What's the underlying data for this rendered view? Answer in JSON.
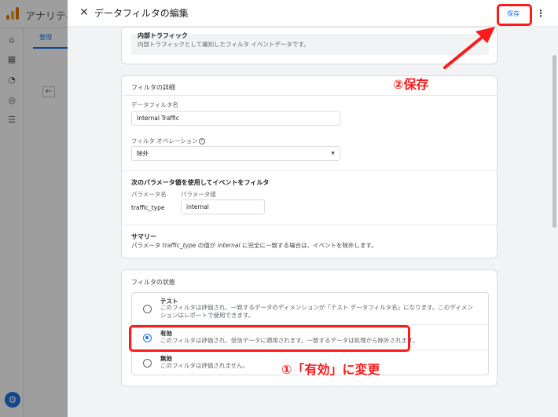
{
  "background": {
    "app_title": "アナリティ",
    "admin_tab": "管理",
    "back_icon": "arrow-left-icon",
    "rail_icons": [
      "home-icon",
      "reports-icon",
      "explore-icon",
      "advertising-icon",
      "list-icon"
    ],
    "settings_icon": "gear-icon"
  },
  "header": {
    "close_icon": "close-icon",
    "title": "データフィルタの編集",
    "save_label": "保存",
    "more_icon": "more-vert-icon"
  },
  "traffic_type": {
    "title": "内部トラフィック",
    "description": "内部トラフィックとして識別したフィルタ イベントデータです。"
  },
  "details": {
    "section_title": "フィルタの詳細",
    "name_label": "データフィルタ名",
    "name_value": "Internal Traffic",
    "operation_label": "フィルタ オペレーション",
    "operation_help": "?",
    "operation_value": "除外",
    "param_heading": "次のパラメータ値を使用してイベントをフィルタ",
    "param_name_header": "パラメータ名",
    "param_value_header": "パラメータ値",
    "param_name": "traffic_type",
    "param_value": "internal",
    "summary_title": "サマリー",
    "summary": {
      "p1": "パラメータ ",
      "param": "traffic_type",
      "p2": " の値が ",
      "value": "internal",
      "p3": " に完全に一致する場合は、イベントを除外します。"
    }
  },
  "state": {
    "section_title": "フィルタの状態",
    "options": [
      {
        "title": "テスト",
        "description": "このフィルタは評価され、一致するデータのディメンションが「テスト データフィルタ名」になります。このディメンションはレポートで使用できます。",
        "selected": false
      },
      {
        "title": "有効",
        "description": "このフィルタは評価され、受信データに適用されます。一致するデータは処理から除外されます。",
        "selected": true
      },
      {
        "title": "無効",
        "description": "このフィルタは評価されません。",
        "selected": false
      }
    ]
  },
  "annotations": {
    "save_note": "②保存",
    "active_note": "①「有効」に変更",
    "color": "#ff1a1a"
  },
  "colors": {
    "accent": "#1a73e8",
    "panel_bg": "#f1f3f4"
  }
}
